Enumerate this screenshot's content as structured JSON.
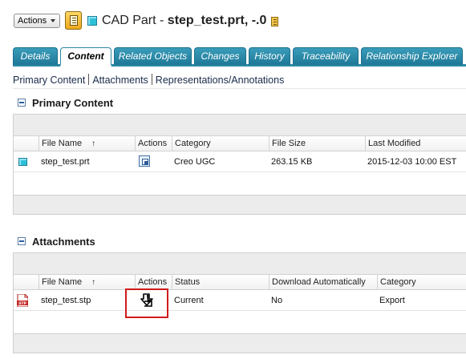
{
  "header": {
    "actions_label": "Actions",
    "title_prefix": "CAD Part - ",
    "title_name": "step_test.prt, -.0"
  },
  "tabs": [
    {
      "label": "Details",
      "active": false
    },
    {
      "label": "Content",
      "active": true
    },
    {
      "label": "Related Objects",
      "active": false
    },
    {
      "label": "Changes",
      "active": false
    },
    {
      "label": "History",
      "active": false
    },
    {
      "label": "Traceability",
      "active": false
    },
    {
      "label": "Relationship Explorer",
      "active": false
    }
  ],
  "subnav": [
    "Primary Content",
    "Attachments",
    "Representations/Annotations"
  ],
  "primary": {
    "heading": "Primary Content",
    "columns": [
      "File Name",
      "Actions",
      "Category",
      "File Size",
      "Last Modified"
    ],
    "sort_arrow": "↑",
    "rows": [
      {
        "icon": "cad-part-icon",
        "file_name": "step_test.prt",
        "action_icon": "view-content-icon",
        "category": "Creo UGC",
        "file_size": "263.15 KB",
        "last_modified": "2015-12-03 10:00 EST"
      }
    ]
  },
  "attachments": {
    "heading": "Attachments",
    "columns": [
      "File Name",
      "Actions",
      "Status",
      "Download Automatically",
      "Category"
    ],
    "sort_arrow": "↑",
    "rows": [
      {
        "icon": "stp-file-icon",
        "file_name": "step_test.stp",
        "action_icon": "download-icon",
        "status": "Current",
        "download_automatically": "No",
        "category": "Export"
      }
    ]
  },
  "colors": {
    "tab_blue": "#1e7897",
    "highlight_red": "#d01b1b",
    "section_gray": "#ececec"
  }
}
